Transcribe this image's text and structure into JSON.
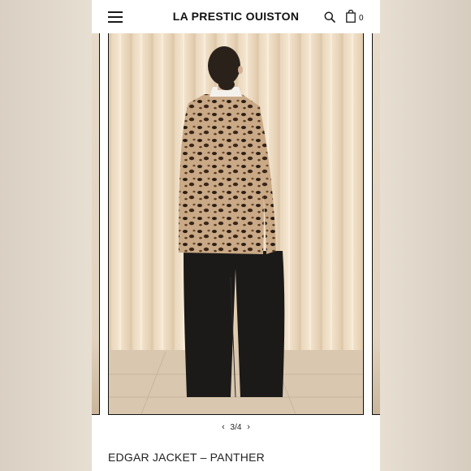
{
  "header": {
    "brand": "LA PRESTIC OUISTON",
    "cart_count": "0",
    "icons": [
      "hamburger-menu-icon",
      "search-icon",
      "shopping-bag-icon"
    ]
  },
  "carousel": {
    "current": 3,
    "total": 4,
    "indicator": "3/4",
    "prev_arrow": "‹",
    "next_arrow": "›"
  },
  "product": {
    "title": "EDGAR JACKET – PANTHER"
  },
  "colors": {
    "background": "#ffffff",
    "text": "#111111",
    "curtain": "#eddcc4",
    "floor": "#d9c7b0",
    "trousers": "#1b1a19",
    "leopard_base": "#c9a986"
  }
}
